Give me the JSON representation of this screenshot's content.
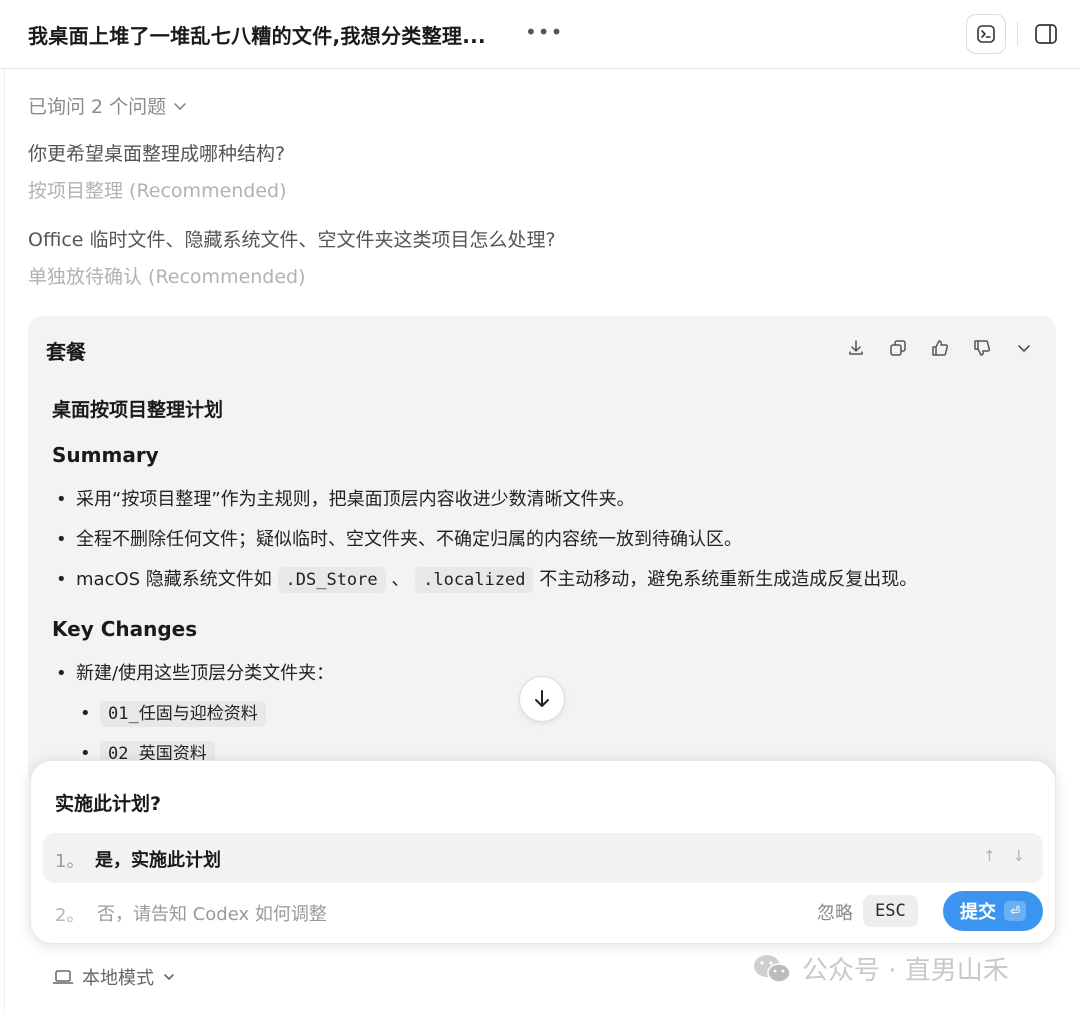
{
  "header": {
    "title": "我桌面上堆了一堆乱七八糟的文件,我想分类整理...",
    "more_icon": "more-horizontal-icon",
    "terminal_icon": "terminal-icon",
    "sidebar_icon": "sidebar-toggle-icon"
  },
  "asked": {
    "label": "已询问 2 个问题"
  },
  "qa": [
    {
      "question": "你更希望桌面整理成哪种结构?",
      "answer": "按项目整理 (Recommended)"
    },
    {
      "question": "Office 临时文件、隐藏系统文件、空文件夹这类项目怎么处理?",
      "answer": "单独放待确认 (Recommended)"
    }
  ],
  "plan": {
    "card_title": "套餐",
    "heading": "桌面按项目整理计划",
    "summary_title": "Summary",
    "summary_items": [
      "采用“按项目整理”作为主规则，把桌面顶层内容收进少数清晰文件夹。",
      "全程不删除任何文件；疑似临时、空文件夹、不确定归属的内容统一放到待确认区。"
    ],
    "summary_item3": {
      "prefix": "macOS 隐藏系统文件如",
      "code1": ".DS_Store",
      "sep": "、",
      "code2": ".localized",
      "suffix": "不主动移动，避免系统重新生成造成反复出现。"
    },
    "key_changes_title": "Key Changes",
    "key_changes_item": "新建/使用这些顶层分类文件夹：",
    "folders": [
      "01_任固与迎检资料",
      "02_英国资料"
    ]
  },
  "dialog": {
    "question": "实施此计划?",
    "option1_num": "1。",
    "option1_label": "是，实施此计划",
    "option1_arrows": "↑ ↓",
    "option2_num": "2。",
    "option2_label": "否，请告知 Codex 如何调整",
    "ignore_label": "忽略",
    "esc_label": "ESC",
    "submit_label": "提交"
  },
  "footer": {
    "mode_label": "本地模式"
  },
  "watermark": {
    "text": "公众号 · 直男山禾"
  },
  "colors": {
    "accent": "#3b95f0",
    "card_bg": "#f3f3f4"
  }
}
